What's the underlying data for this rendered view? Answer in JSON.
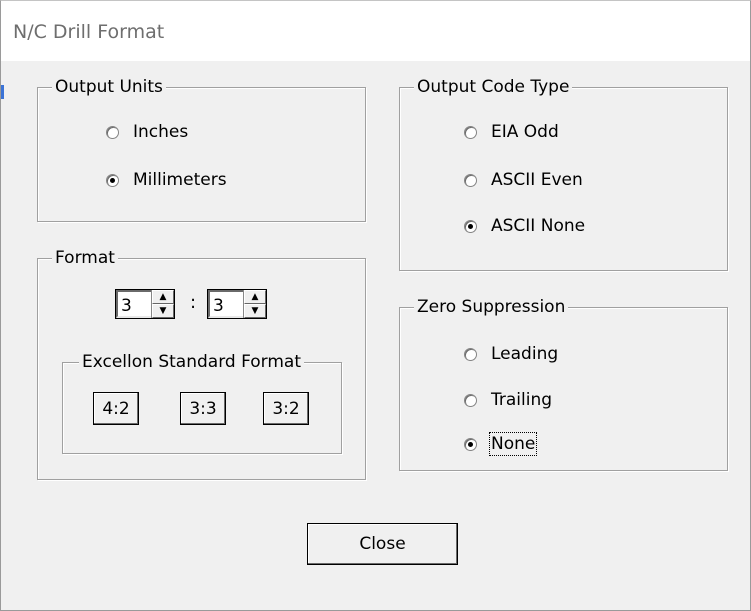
{
  "window": {
    "title": "N/C Drill Format"
  },
  "output_units": {
    "legend": "Output Units",
    "options": [
      {
        "label": "Inches",
        "checked": false
      },
      {
        "label": "Millimeters",
        "checked": true
      }
    ]
  },
  "output_code_type": {
    "legend": "Output Code Type",
    "options": [
      {
        "label": "EIA Odd",
        "checked": false
      },
      {
        "label": "ASCII Even",
        "checked": false
      },
      {
        "label": "ASCII None",
        "checked": true
      }
    ]
  },
  "format": {
    "legend": "Format",
    "integer_digits": "3",
    "separator": ":",
    "decimal_digits": "3",
    "excellon": {
      "legend": "Excellon Standard Format",
      "buttons": [
        "4:2",
        "3:3",
        "3:2"
      ]
    }
  },
  "zero_suppression": {
    "legend": "Zero Suppression",
    "options": [
      {
        "label": "Leading",
        "checked": false
      },
      {
        "label": "Trailing",
        "checked": false
      },
      {
        "label": "None",
        "checked": true
      }
    ]
  },
  "close_button": {
    "label": "Close"
  }
}
